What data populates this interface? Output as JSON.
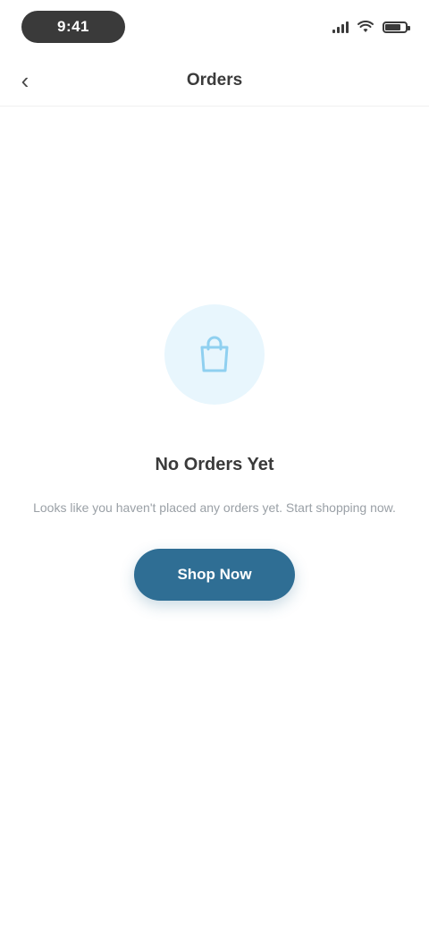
{
  "status_bar": {
    "time": "9:41",
    "icons": [
      "signal-icon",
      "wifi-icon",
      "battery-icon"
    ]
  },
  "nav": {
    "back_icon": "back-arrow-icon",
    "title": "Orders"
  },
  "empty_state": {
    "icon": "bag-icon",
    "title": "No Orders Yet",
    "subtitle": "Looks like you haven't placed any orders yet. Start shopping now.",
    "button_label": "Shop Now"
  },
  "colors": {
    "accent": "#2f6e94",
    "icon_background": "#e8f6fd",
    "icon_foreground": "#8fd0f0"
  }
}
